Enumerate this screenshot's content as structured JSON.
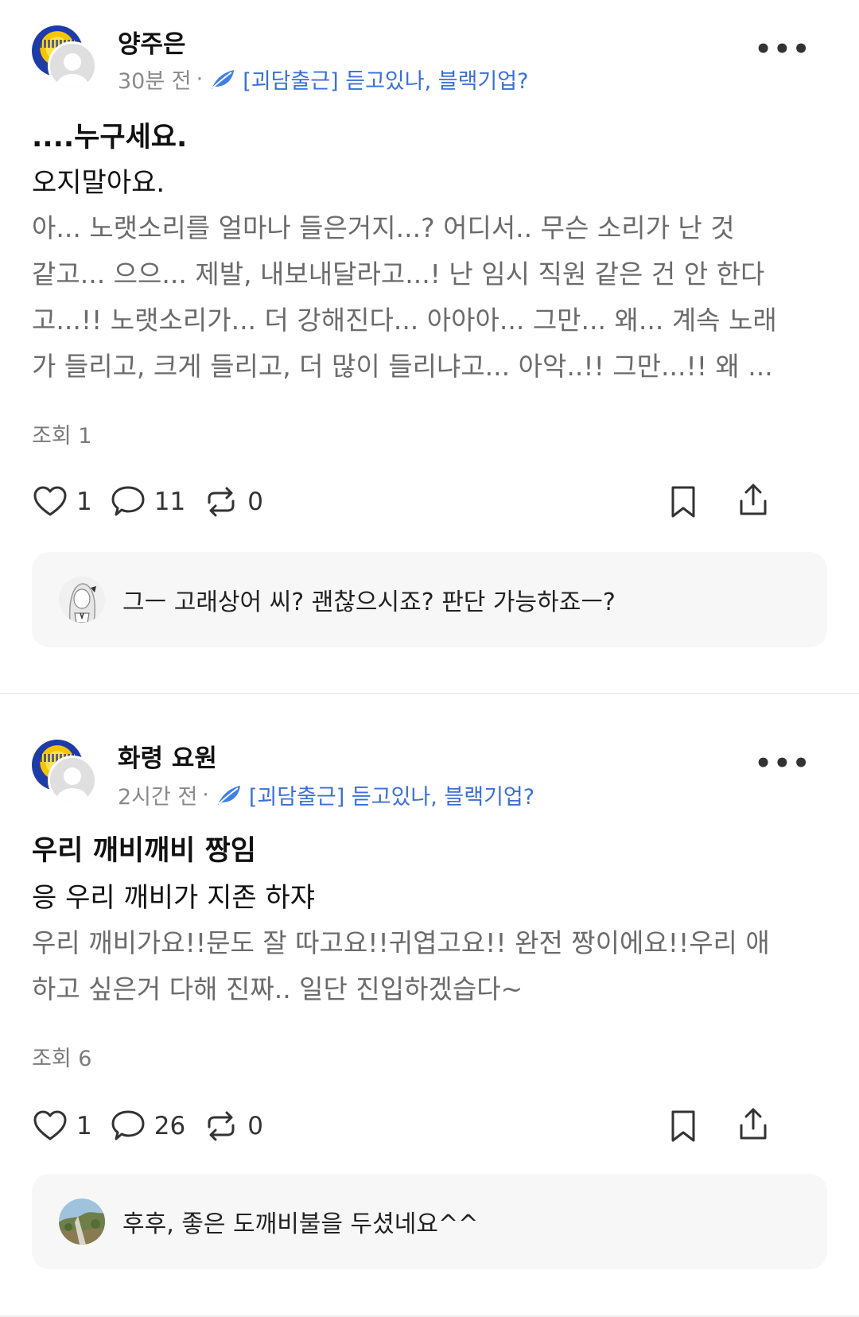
{
  "posts": [
    {
      "username": "양주은",
      "time": "30분 전",
      "dot": "·",
      "topic": "[괴담출근] 듣고있나, 블랙기업?",
      "more": "•••",
      "title": "....누구세요.",
      "subtitle": "오지말아요.",
      "body_lines": [
        "아... 노랫소리를 얼마나 들은거지...? 어디서.. 무슨 소리가 난 것",
        "같고... 으으... 제발, 내보내달라고...! 난 임시 직원 같은 건 안 한다",
        "고...!! 노랫소리가... 더 강해진다... 아아아... 그만... 왜... 계속 노래",
        "가 들리고, 크게 들리고, 더 많이 들리냐고... 아악..!! 그만...!! 왜 ..."
      ],
      "views": "조회 1",
      "likes": "1",
      "comments": "11",
      "reposts": "0",
      "reply": {
        "text": "그ㅡ 고래상어 씨? 괜찮으시죠? 판단 가능하죠ㅡ?",
        "avatar": "anime-sketch-avatar"
      }
    },
    {
      "username": "화령 요원",
      "time": "2시간 전",
      "dot": "·",
      "topic": "[괴담출근] 듣고있나, 블랙기업?",
      "more": "•••",
      "title": "우리 깨비깨비 짱임",
      "subtitle": "응 우리 깨비가 지존 하쟈",
      "body_lines": [
        "우리 깨비가요!!문도 잘 따고요!!귀엽고요!! 완전 짱이에요!!우리 애",
        "하고 싶은거 다해 진짜.. 일단 진입하겠습다~"
      ],
      "views": "조회 6",
      "likes": "1",
      "comments": "26",
      "reposts": "0",
      "reply": {
        "text": "후후, 좋은 도깨비불을 두셨네요^^",
        "avatar": "landscape-photo-avatar"
      }
    }
  ],
  "colors": {
    "topic": "#3b6fd8",
    "leaf": "#3f7fe6",
    "reply_bg": "#f7f7f7",
    "muted": "#8a8a8a"
  },
  "icons": [
    "heart-icon",
    "comment-icon",
    "repost-icon",
    "bookmark-icon",
    "share-icon",
    "leaf-icon",
    "more-icon"
  ]
}
